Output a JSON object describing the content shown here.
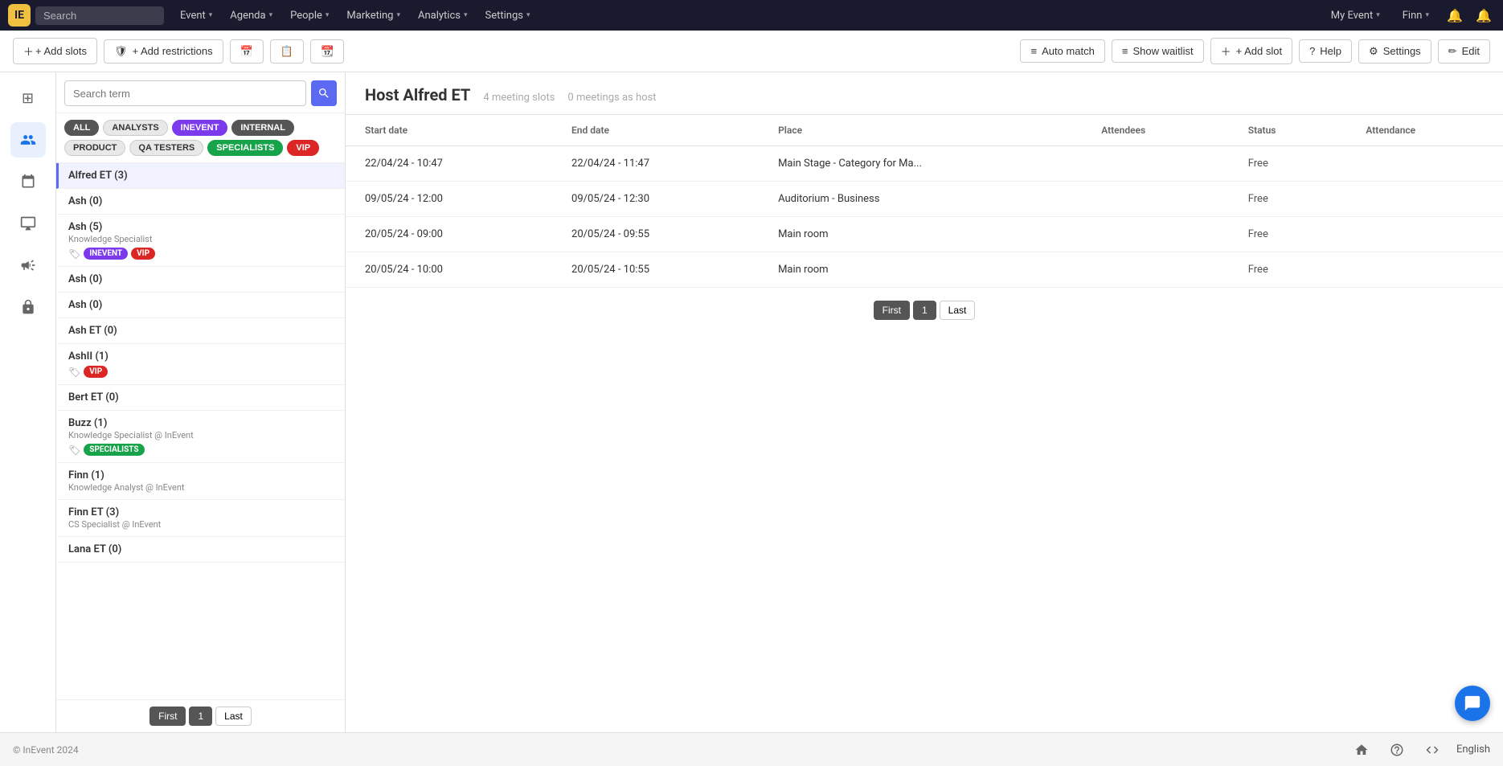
{
  "logo": {
    "text": "IE"
  },
  "topnav": {
    "search_placeholder": "Search",
    "items": [
      {
        "label": "Event",
        "id": "event"
      },
      {
        "label": "Agenda",
        "id": "agenda"
      },
      {
        "label": "People",
        "id": "people"
      },
      {
        "label": "Marketing",
        "id": "marketing"
      },
      {
        "label": "Analytics",
        "id": "analytics"
      },
      {
        "label": "Settings",
        "id": "settings"
      }
    ],
    "my_event": "My Event",
    "user": "Finn"
  },
  "toolbar": {
    "add_slots_label": "+ Add slots",
    "add_restrictions_label": "+ Add restrictions",
    "calendar_icon": "📅",
    "auto_match_label": "Auto match",
    "show_waitlist_label": "Show waitlist",
    "add_slot_label": "+ Add slot",
    "help_label": "Help",
    "settings_label": "Settings",
    "edit_label": "Edit"
  },
  "left_panel": {
    "search_placeholder": "Search term",
    "tag_filters": [
      {
        "label": "ALL",
        "id": "all",
        "cls": "active-all"
      },
      {
        "label": "ANALYSTS",
        "id": "analysts",
        "cls": "analysts"
      },
      {
        "label": "INEVENT",
        "id": "inevent",
        "cls": "inevent"
      },
      {
        "label": "INTERNAL",
        "id": "internal",
        "cls": "internal"
      },
      {
        "label": "PRODUCT",
        "id": "product",
        "cls": "product"
      },
      {
        "label": "QA TESTERS",
        "id": "qa-testers",
        "cls": "qa-testers"
      },
      {
        "label": "SPECIALISTS",
        "id": "specialists",
        "cls": "specialists"
      },
      {
        "label": "VIP",
        "id": "vip",
        "cls": "vip"
      }
    ],
    "people": [
      {
        "name": "Alfred ET (3)",
        "role": "",
        "tags": [],
        "selected": true
      },
      {
        "name": "Ash (0)",
        "role": "",
        "tags": []
      },
      {
        "name": "Ash (5)",
        "role": "Knowledge Specialist",
        "tags": [
          {
            "label": "INEVENT",
            "cls": "tag-inevent"
          },
          {
            "label": "VIP",
            "cls": "tag-vip"
          }
        ]
      },
      {
        "name": "Ash (0)",
        "role": "",
        "tags": []
      },
      {
        "name": "Ash (0)",
        "role": "",
        "tags": []
      },
      {
        "name": "Ash ET (0)",
        "role": "",
        "tags": []
      },
      {
        "name": "AshII (1)",
        "role": "",
        "tags": [
          {
            "label": "VIP",
            "cls": "tag-vip"
          }
        ]
      },
      {
        "name": "Bert ET (0)",
        "role": "",
        "tags": []
      },
      {
        "name": "Buzz (1)",
        "role": "Knowledge Specialist @ InEvent",
        "tags": [
          {
            "label": "SPECIALISTS",
            "cls": "tag-specialists"
          }
        ]
      },
      {
        "name": "Finn (1)",
        "role": "Knowledge Analyst @ InEvent",
        "tags": []
      },
      {
        "name": "Finn ET (3)",
        "role": "CS Specialist @ InEvent",
        "tags": []
      },
      {
        "name": "Lana ET (0)",
        "role": "",
        "tags": []
      }
    ],
    "pagination": {
      "first": "First",
      "page": "1",
      "last": "Last"
    }
  },
  "host_detail": {
    "title": "Host Alfred ET",
    "meeting_slots": "4 meeting slots",
    "meetings_as_host": "0 meetings as host",
    "table": {
      "columns": [
        "Start date",
        "End date",
        "Place",
        "Attendees",
        "Status",
        "Attendance"
      ],
      "rows": [
        {
          "start": "22/04/24 - 10:47",
          "end": "22/04/24 - 11:47",
          "place": "Main Stage - Category for Ma...",
          "attendees": "",
          "status": "Free",
          "attendance": ""
        },
        {
          "start": "09/05/24 - 12:00",
          "end": "09/05/24 - 12:30",
          "place": "Auditorium - Business",
          "attendees": "",
          "status": "Free",
          "attendance": ""
        },
        {
          "start": "20/05/24 - 09:00",
          "end": "20/05/24 - 09:55",
          "place": "Main room",
          "attendees": "",
          "status": "Free",
          "attendance": ""
        },
        {
          "start": "20/05/24 - 10:00",
          "end": "20/05/24 - 10:55",
          "place": "Main room",
          "attendees": "",
          "status": "Free",
          "attendance": ""
        }
      ]
    },
    "pagination": {
      "first": "First",
      "page": "1",
      "last": "Last"
    }
  },
  "footer": {
    "copyright": "© InEvent 2024",
    "language": "English"
  },
  "side_icons": [
    {
      "id": "dashboard",
      "symbol": "⊞"
    },
    {
      "id": "people",
      "symbol": "👤",
      "active": true
    },
    {
      "id": "calendar",
      "symbol": "📅"
    },
    {
      "id": "monitor",
      "symbol": "🖥"
    },
    {
      "id": "megaphone",
      "symbol": "📣"
    },
    {
      "id": "lock",
      "symbol": "🔒"
    }
  ]
}
